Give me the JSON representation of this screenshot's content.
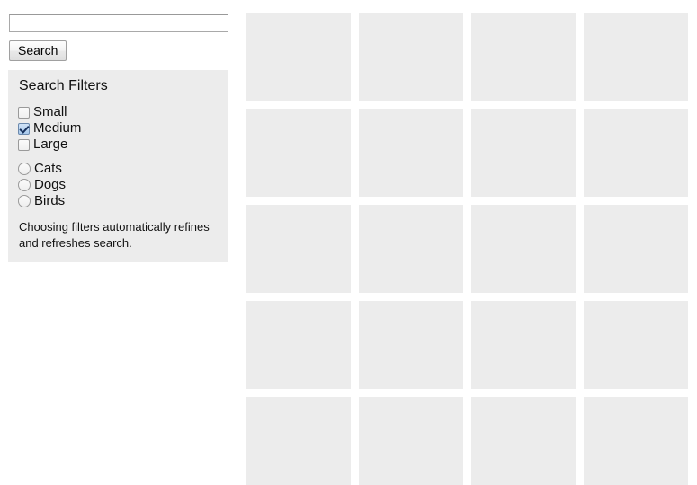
{
  "search": {
    "input_value": "",
    "placeholder": "",
    "button_label": "Search"
  },
  "filters": {
    "title": "Search Filters",
    "size_options": [
      {
        "label": "Small",
        "checked": false
      },
      {
        "label": "Medium",
        "checked": true
      },
      {
        "label": "Large",
        "checked": false
      }
    ],
    "animal_options": [
      {
        "label": "Cats",
        "selected": false
      },
      {
        "label": "Dogs",
        "selected": false
      },
      {
        "label": "Birds",
        "selected": false
      }
    ],
    "note": "Choosing filters automatically refines and refreshes search."
  },
  "results": {
    "columns": 4,
    "rows": 5,
    "cell_count": 20,
    "cells": [
      {},
      {},
      {},
      {},
      {},
      {},
      {},
      {},
      {},
      {},
      {},
      {},
      {},
      {},
      {},
      {},
      {},
      {},
      {},
      {}
    ]
  },
  "colors": {
    "page_background": "#ffffff",
    "panel_background": "#ececec",
    "placeholder_cell": "#ececec",
    "checkbox_checked_fill": "#b8d4f0",
    "checkbox_check_mark": "#16305c",
    "control_border": "#9a9a9a",
    "text": "#111111"
  }
}
